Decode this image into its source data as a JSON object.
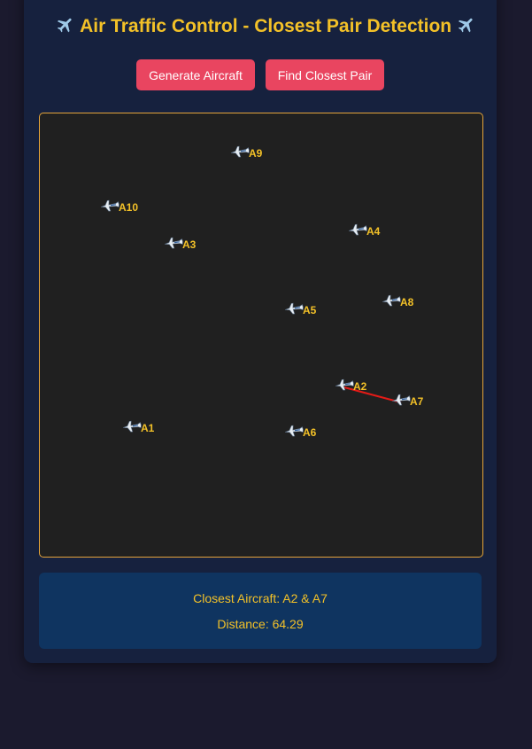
{
  "header": {
    "title": "Air Traffic Control - Closest Pair Detection",
    "title_icon": "airplane-icon"
  },
  "toolbar": {
    "generate_label": "Generate Aircraft",
    "find_label": "Find Closest Pair"
  },
  "aircraft": [
    {
      "label": "A1"
    },
    {
      "label": "A2"
    },
    {
      "label": "A3"
    },
    {
      "label": "A4"
    },
    {
      "label": "A5"
    },
    {
      "label": "A6"
    },
    {
      "label": "A7"
    },
    {
      "label": "A8"
    },
    {
      "label": "A9"
    },
    {
      "label": "A10"
    }
  ],
  "closest_pair": {
    "from": "A2",
    "to": "A7",
    "line_color": "#e41b17"
  },
  "result": {
    "closest_text": "Closest Aircraft: A2 & A7",
    "distance_text": "Distance: 64.29"
  },
  "colors": {
    "accent": "#f3c128",
    "button": "#e94560",
    "canvas_border": "#e5a43a"
  }
}
